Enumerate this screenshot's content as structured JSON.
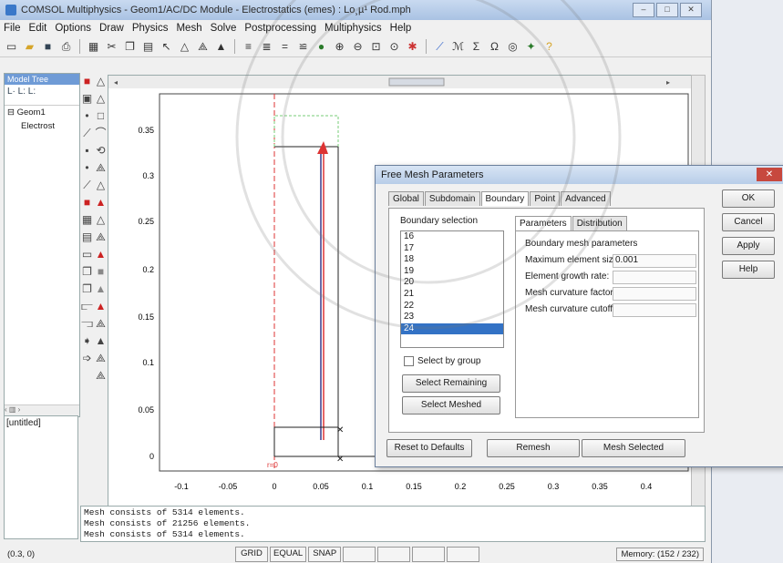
{
  "window": {
    "title": "COMSOL Multiphysics - Geom1/AC/DC Module - Electrostatics (emes) : Lo¸µ¹ Rod.mph",
    "min": "–",
    "max": "□",
    "close": "✕"
  },
  "menu": [
    "File",
    "Edit",
    "Options",
    "Draw",
    "Physics",
    "Mesh",
    "Solve",
    "Postprocessing",
    "Multiphysics",
    "Help"
  ],
  "toolbar_icons": [
    "new-icon",
    "open-icon",
    "save-icon",
    "print-icon",
    "table-icon",
    "cut-icon",
    "copy-icon",
    "paste-icon",
    "pointer-icon",
    "triangle-icon",
    "triangle-outline-icon",
    "mesh-icon",
    "grid-icon",
    "align-icon",
    "equal-icon",
    "refine-icon",
    "globe-icon",
    "zoom-in-icon",
    "zoom-out-icon",
    "zoom-box-icon",
    "zoom-extents-icon",
    "star-icon",
    "plot-icon",
    "model-icon",
    "solve-icon",
    "omega-icon",
    "sphere-icon",
    "tools-icon",
    "help-icon"
  ],
  "model_tree": {
    "header": "Model Tree",
    "tools": "L· L: L:",
    "node_geom": "⊟ Geom1",
    "node_child": "Electrost",
    "scroll": "‹ ▥ ›"
  },
  "untitled_label": "[untitled]",
  "plot": {
    "y_ticks": [
      "0.35",
      "0.3",
      "0.25",
      "0.2",
      "0.15",
      "0.1",
      "0.05",
      "0"
    ],
    "x_ticks": [
      "-0.1",
      "-0.05",
      "0",
      "0.05",
      "0.1",
      "0.15",
      "0.2",
      "0.25",
      "0.3",
      "0.35",
      "0.4"
    ],
    "r0_label": "r=0"
  },
  "console": [
    "Mesh consists of 5314 elements.",
    "Mesh consists of 21256 elements.",
    "Mesh consists of 5314 elements."
  ],
  "status": {
    "coord": "(0.3, 0)",
    "grid": "GRID",
    "equal": "EQUAL",
    "snap": "SNAP",
    "memory": "Memory: (152 / 232)"
  },
  "dialog": {
    "title": "Free Mesh Parameters",
    "close": "✕",
    "tabs": [
      "Global",
      "Subdomain",
      "Boundary",
      "Point",
      "Advanced"
    ],
    "active_tab": "Boundary",
    "boundary_selection_label": "Boundary selection",
    "boundaries": [
      "16",
      "17",
      "18",
      "19",
      "20",
      "21",
      "22",
      "23",
      "24"
    ],
    "selected_boundary": "24",
    "select_by_group": "Select by group",
    "select_remaining": "Select Remaining",
    "select_meshed": "Select Meshed",
    "subtabs": [
      "Parameters",
      "Distribution"
    ],
    "params_header": "Boundary mesh parameters",
    "params": [
      {
        "label": "Maximum element size:",
        "value": "0.001"
      },
      {
        "label": "Element growth rate:",
        "value": ""
      },
      {
        "label": "Mesh curvature factor:",
        "value": ""
      },
      {
        "label": "Mesh curvature cutoff:",
        "value": ""
      }
    ],
    "ok": "OK",
    "cancel": "Cancel",
    "apply": "Apply",
    "help": "Help",
    "reset": "Reset to Defaults",
    "remesh": "Remesh",
    "mesh_selected": "Mesh Selected"
  }
}
